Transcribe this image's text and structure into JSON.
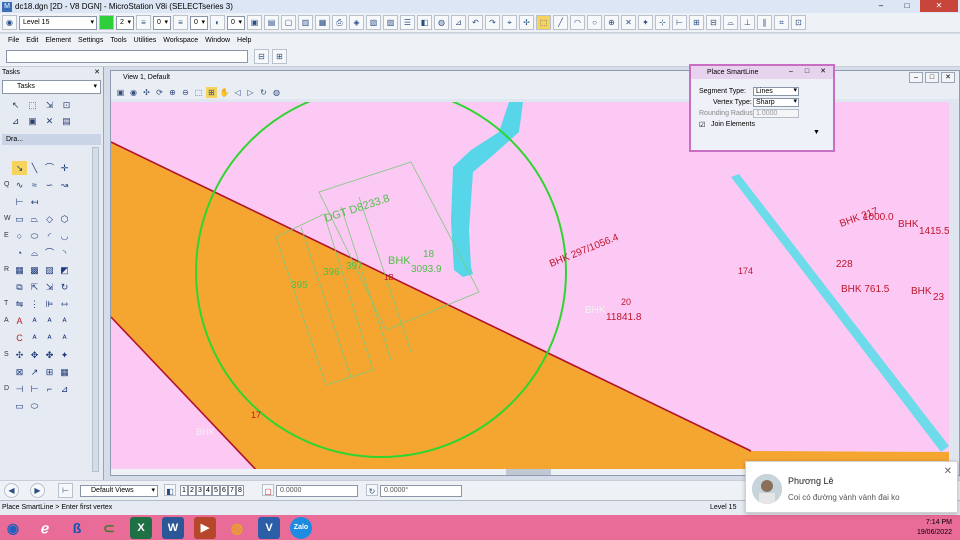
{
  "app": {
    "title": "dc18.dgn [2D - V8 DGN] - MicroStation V8i (SELECTseries 3)",
    "icon_label": "M",
    "controls": {
      "minimize": "–",
      "maximize": "□",
      "close": "✕"
    }
  },
  "toolbar": {
    "level_value": "Level 15",
    "color_value": "2",
    "style_value": "0",
    "weight_value": "0",
    "transparency_value": "0"
  },
  "menu": [
    "File",
    "Edit",
    "Element",
    "Settings",
    "Tools",
    "Utilities",
    "Workspace",
    "Window",
    "Help"
  ],
  "tasks_panel": {
    "title": "Tasks",
    "combo_value": "Tasks",
    "close": "✕",
    "draw_section": "Dra...",
    "row_letters": [
      "Q",
      "W",
      "E",
      "R",
      "T",
      "A",
      "S",
      "D"
    ]
  },
  "view": {
    "title": "View 1, Default"
  },
  "dialog": {
    "title": "Place SmartLine",
    "segment_type_label": "Segment Type:",
    "segment_type_value": "Lines",
    "vertex_type_label": "Vertex Type:",
    "vertex_type_value": "Sharp",
    "rounding_label": "Rounding Radius:",
    "rounding_value": "1.0000",
    "join_label": "Join Elements",
    "join_checked": true
  },
  "map_labels": {
    "dgt_d8238": "DGT D8233.8",
    "bhk_main": "BHK",
    "n18": "18",
    "n3093": "3093.9",
    "n397": "397",
    "n396": "396",
    "n395": "395",
    "bhk_297": "BHK 297/1056.4",
    "bhk_20": "BHK",
    "n20": "20",
    "n11841": "11841.8",
    "bhk_217": "BHK 217",
    "n1000": "1000.0",
    "bhk_1415": "BHK",
    "n1415": "1415.5",
    "n228": "228",
    "bhk_761": "BHK 761.5",
    "bhk_23": "BHK",
    "n23": "23",
    "n174": "174",
    "bhk_17": "BHK",
    "n17": "17",
    "n1b": "1B"
  },
  "bottom_toolbar": {
    "views_value": "Default Views",
    "view_numbers": [
      "1",
      "2",
      "3",
      "4",
      "5",
      "6",
      "7",
      "8"
    ],
    "angle_field": "0.0000",
    "rotation_field": "0.0000°"
  },
  "status": {
    "prompt": "Place SmartLine > Enter first vertex",
    "level": "Level 15"
  },
  "taskbar": {
    "time": "7:14 PM",
    "date": "19/06/2022",
    "zalo_label": "Zalo"
  },
  "toast": {
    "name": "Phương Lê",
    "message": "Coi có đường vành vành đai ko",
    "close": "✕"
  },
  "colors": {
    "canvas": "#fbc9f4",
    "road": "#f5a631",
    "circle": "#2fd52f",
    "water": "#56d6e8",
    "label_red": "#c0152b",
    "taskbar": "#e96b97"
  }
}
